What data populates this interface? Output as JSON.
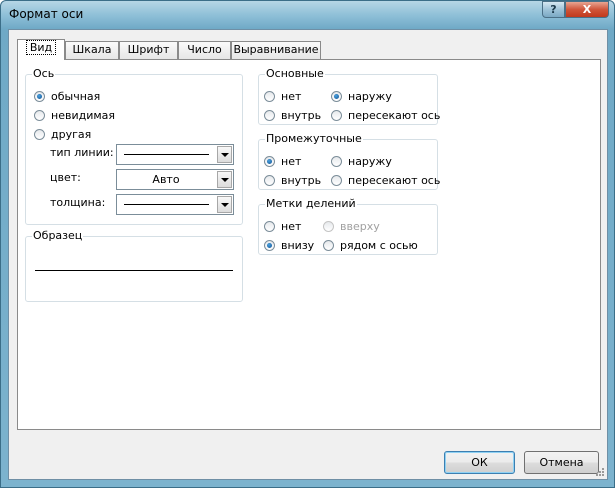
{
  "window": {
    "title": "Формат оси",
    "help_label": "?",
    "close_label": "X"
  },
  "tabs": [
    "Вид",
    "Шкала",
    "Шрифт",
    "Число",
    "Выравнивание"
  ],
  "axis": {
    "label": "Ось",
    "options": [
      "обычная",
      "невидимая",
      "другая"
    ],
    "selected": "обычная",
    "line_type_label": "тип линии:",
    "color_label": "цвет:",
    "color_value": "Авто",
    "weight_label": "толщина:"
  },
  "sample": {
    "label": "Образец"
  },
  "major": {
    "label": "Основные",
    "options": [
      "нет",
      "наружу",
      "внутрь",
      "пересекают ось"
    ],
    "selected": "наружу"
  },
  "minor": {
    "label": "Промежуточные",
    "options": [
      "нет",
      "наружу",
      "внутрь",
      "пересекают ось"
    ],
    "selected": "нет"
  },
  "tick_labels": {
    "label": "Метки делений",
    "options": [
      "нет",
      "вверху",
      "внизу",
      "рядом с осью"
    ],
    "selected": "внизу",
    "disabled": [
      "вверху"
    ]
  },
  "buttons": {
    "ok": "ОК",
    "cancel": "Отмена"
  }
}
